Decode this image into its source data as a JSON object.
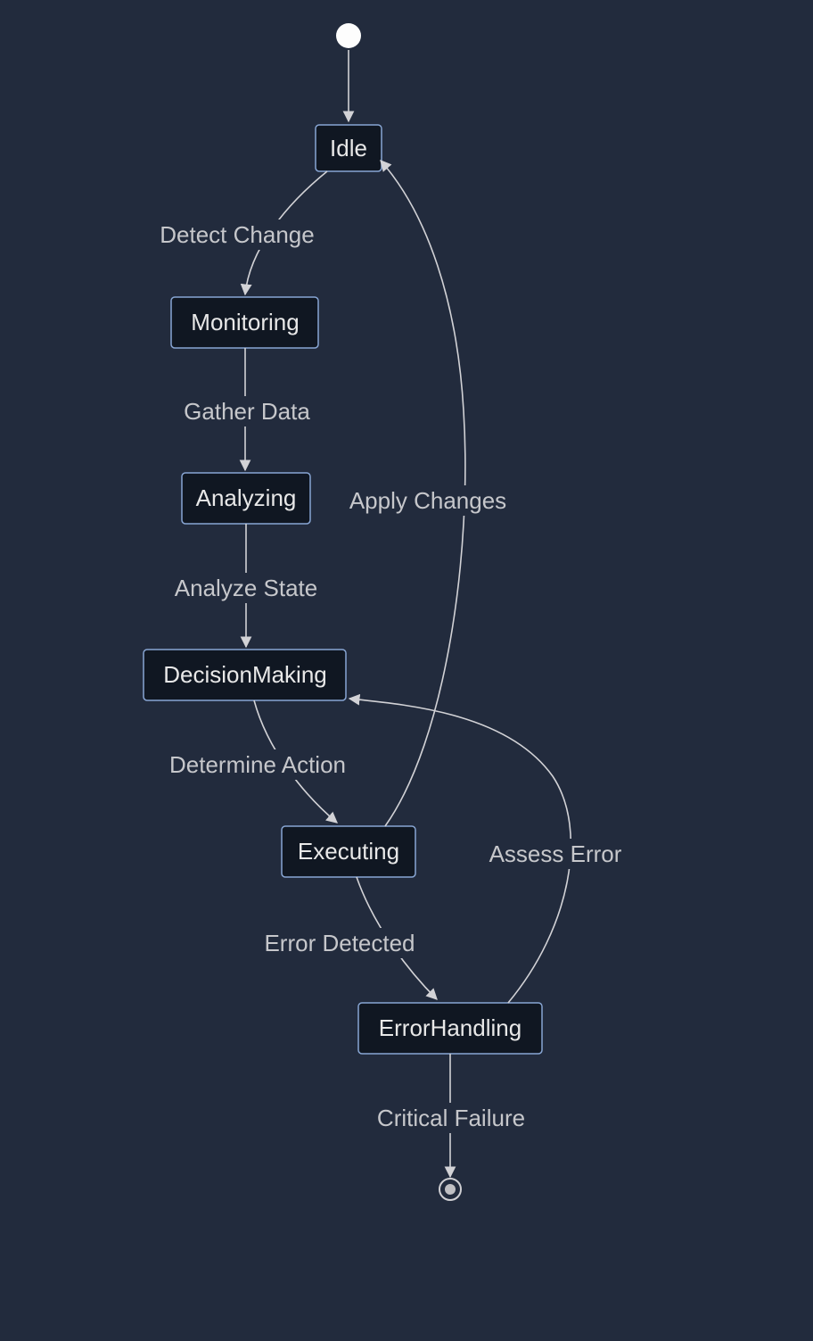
{
  "diagram": {
    "type": "state",
    "states": {
      "idle": "Idle",
      "monitoring": "Monitoring",
      "analyzing": "Analyzing",
      "decision_making": "DecisionMaking",
      "executing": "Executing",
      "error_handling": "ErrorHandling"
    },
    "transitions": {
      "detect_change": "Detect Change",
      "gather_data": "Gather Data",
      "analyze_state": "Analyze State",
      "determine_action": "Determine Action",
      "error_detected": "Error Detected",
      "critical_failure": "Critical Failure",
      "apply_changes": "Apply Changes",
      "assess_error": "Assess Error"
    },
    "edges": [
      {
        "from": "start",
        "to": "idle",
        "label_key": null
      },
      {
        "from": "idle",
        "to": "monitoring",
        "label_key": "detect_change"
      },
      {
        "from": "monitoring",
        "to": "analyzing",
        "label_key": "gather_data"
      },
      {
        "from": "analyzing",
        "to": "decision_making",
        "label_key": "analyze_state"
      },
      {
        "from": "decision_making",
        "to": "executing",
        "label_key": "determine_action"
      },
      {
        "from": "executing",
        "to": "error_handling",
        "label_key": "error_detected"
      },
      {
        "from": "error_handling",
        "to": "end",
        "label_key": "critical_failure"
      },
      {
        "from": "executing",
        "to": "idle",
        "label_key": "apply_changes"
      },
      {
        "from": "error_handling",
        "to": "decision_making",
        "label_key": "assess_error"
      }
    ]
  }
}
